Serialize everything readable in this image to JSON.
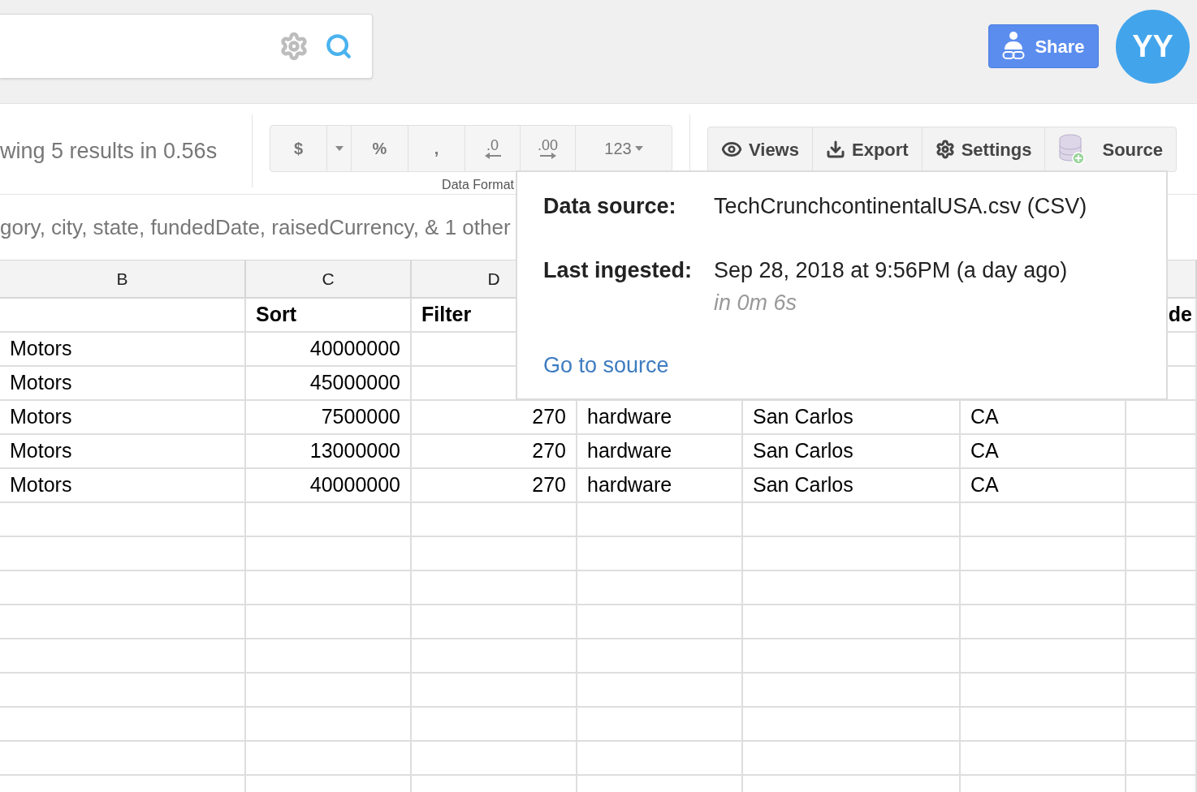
{
  "share_button": {
    "label": "Share"
  },
  "avatar": {
    "initials": "YY"
  },
  "results_summary": "wing 5 results in 0.56s",
  "format_toolbar": {
    "caption": "Data Format",
    "buttons": [
      {
        "kind": "text",
        "label": "$"
      },
      {
        "kind": "caret"
      },
      {
        "kind": "text",
        "label": "%"
      },
      {
        "kind": "text",
        "label": ","
      },
      {
        "kind": "decrease",
        "label": ".0"
      },
      {
        "kind": "increase",
        "label": ".00"
      },
      {
        "kind": "dropdown",
        "label": "123"
      }
    ]
  },
  "view_toolbar": [
    {
      "kind": "views",
      "label": "Views"
    },
    {
      "kind": "export",
      "label": "Export"
    },
    {
      "kind": "settings",
      "label": "Settings"
    },
    {
      "kind": "source",
      "label": "Source"
    }
  ],
  "columns_summary": "gory, city, state, fundedDate, raisedCurrency, & 1 other",
  "table": {
    "columns": [
      {
        "letter": "B"
      },
      {
        "letter": "C",
        "label": "Sort"
      },
      {
        "letter": "D",
        "label": "Filter"
      },
      {},
      {},
      {},
      {
        "label": "de"
      }
    ],
    "rows": [
      {
        "cells": [
          "Motors",
          "40000000",
          null,
          null,
          null,
          null,
          null
        ]
      },
      {
        "cells": [
          "Motors",
          "45000000",
          null,
          null,
          null,
          null,
          null
        ]
      },
      {
        "cells": [
          "Motors",
          "7500000",
          "270",
          "hardware",
          "San Carlos",
          "CA",
          null
        ]
      },
      {
        "cells": [
          "Motors",
          "13000000",
          "270",
          "hardware",
          "San Carlos",
          "CA",
          null
        ]
      },
      {
        "cells": [
          "Motors",
          "40000000",
          "270",
          "hardware",
          "San Carlos",
          "CA",
          null
        ]
      }
    ]
  },
  "source_popover": {
    "source_label": "Data source:",
    "source_value": "TechCrunchcontinentalUSA.csv (CSV)",
    "ingested_label": "Last ingested:",
    "ingested_value": "Sep 28, 2018 at 9:56PM (a day ago)",
    "duration": "in 0m 6s",
    "link": "Go to source"
  }
}
